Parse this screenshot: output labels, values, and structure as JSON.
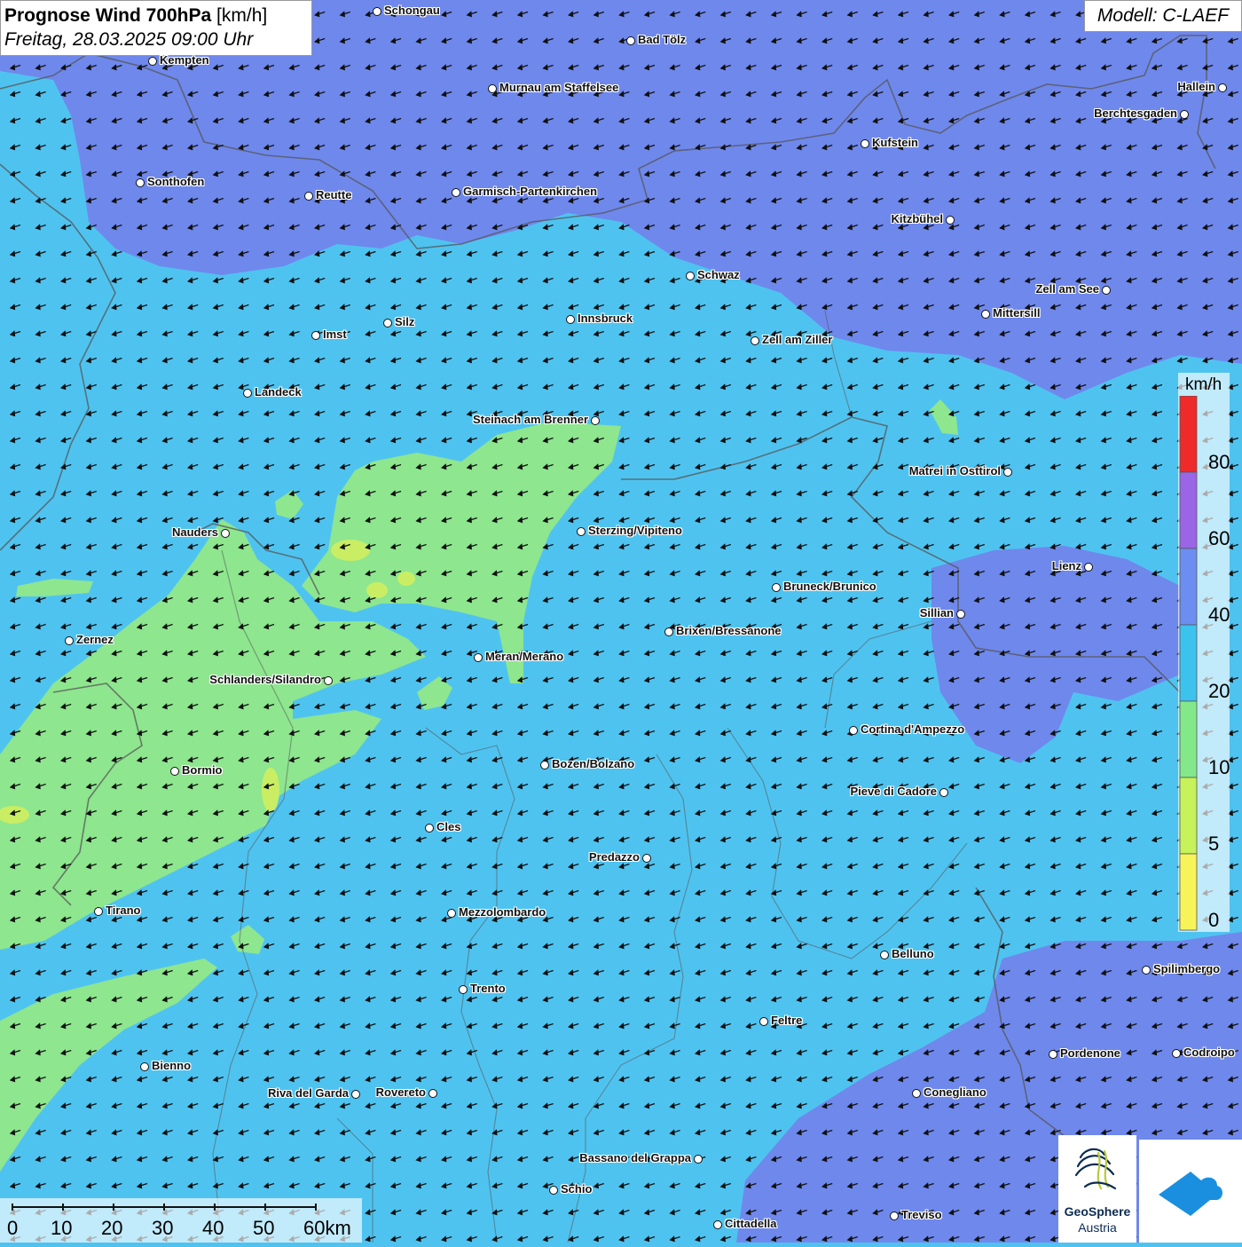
{
  "title": {
    "main": "Prognose Wind 700hPa",
    "unit": "[km/h]",
    "date": "Freitag, 28.03.2025 09:00 Uhr"
  },
  "model": "Modell: C-LAEF",
  "legend": {
    "unit": "km/h",
    "labels": [
      "80",
      "60",
      "40",
      "20",
      "10",
      "5",
      "0"
    ],
    "colors": [
      "#ee2a2a",
      "#9a66e6",
      "#6b8ef0",
      "#3bc3ee",
      "#82e88a",
      "#c6f25a",
      "#f7f45a"
    ]
  },
  "scale": {
    "labels": [
      "0",
      "10",
      "20",
      "30",
      "40",
      "50",
      "60km"
    ]
  },
  "logo": {
    "line1": "GeoSphere",
    "line2": "Austria"
  },
  "wind": {
    "direction": "from NE / E",
    "arrows_point": "west-southwest"
  },
  "cities": [
    {
      "name": "Schongau"
    },
    {
      "name": "Bad Tölz"
    },
    {
      "name": "Kempten"
    },
    {
      "name": "Murnau am Staffelsee"
    },
    {
      "name": "Hallein"
    },
    {
      "name": "Berchtesgaden"
    },
    {
      "name": "Kufstein"
    },
    {
      "name": "Sonthofen"
    },
    {
      "name": "Reutte"
    },
    {
      "name": "Garmisch-Partenkirchen"
    },
    {
      "name": "Kitzbühel"
    },
    {
      "name": "Schwaz"
    },
    {
      "name": "Zell am See"
    },
    {
      "name": "Mittersill"
    },
    {
      "name": "Innsbruck"
    },
    {
      "name": "Silz"
    },
    {
      "name": "Imst"
    },
    {
      "name": "Zell am Ziller"
    },
    {
      "name": "Landeck"
    },
    {
      "name": "Steinach am Brenner"
    },
    {
      "name": "Matrei in Osttirol"
    },
    {
      "name": "Nauders"
    },
    {
      "name": "Sterzing/Vipiteno"
    },
    {
      "name": "Lienz"
    },
    {
      "name": "Bruneck/Brunico"
    },
    {
      "name": "Sillian"
    },
    {
      "name": "Zernez"
    },
    {
      "name": "Brixen/Bressanone"
    },
    {
      "name": "Meran/Merano"
    },
    {
      "name": "Schlanders/Silandro"
    },
    {
      "name": "Cortina d'Ampezzo"
    },
    {
      "name": "Bozen/Bolzano"
    },
    {
      "name": "Bormio"
    },
    {
      "name": "Pieve di Cadore"
    },
    {
      "name": "Cles"
    },
    {
      "name": "Predazzo"
    },
    {
      "name": "Tirano"
    },
    {
      "name": "Mezzolombardo"
    },
    {
      "name": "Belluno"
    },
    {
      "name": "Spilimbergo"
    },
    {
      "name": "Trento"
    },
    {
      "name": "Feltre"
    },
    {
      "name": "Pordenone"
    },
    {
      "name": "Codroipo"
    },
    {
      "name": "Bienno"
    },
    {
      "name": "Riva del Garda"
    },
    {
      "name": "Rovereto"
    },
    {
      "name": "Conegliano"
    },
    {
      "name": "Bassano del Grappa"
    },
    {
      "name": "Schio"
    },
    {
      "name": "Treviso"
    },
    {
      "name": "Cittadella"
    }
  ]
}
